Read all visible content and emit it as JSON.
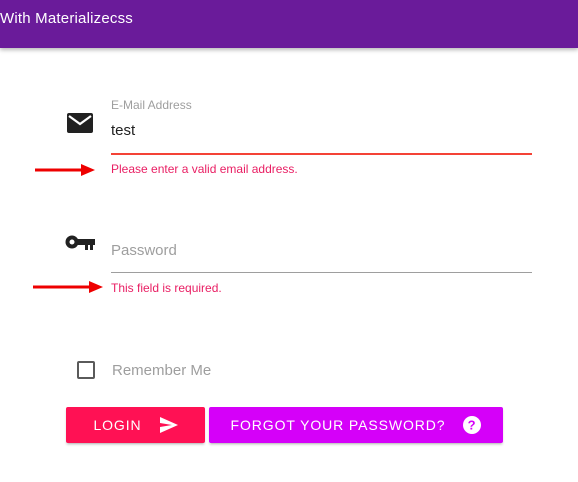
{
  "header": {
    "title": "With Materializecss"
  },
  "form": {
    "email": {
      "label": "E-Mail Address",
      "value": "test",
      "error": "Please enter a valid email address.",
      "icon": "email-icon"
    },
    "password": {
      "placeholder": "Password",
      "error": "This field is required.",
      "icon": "key-icon"
    },
    "remember": {
      "label": "Remember Me",
      "checked": false
    },
    "buttons": {
      "login_label": "LOGIN",
      "login_icon": "send-icon",
      "forgot_label": "FORGOT YOUR PASSWORD?",
      "forgot_icon": "help-icon"
    }
  },
  "annotations": {
    "arrow_color": "#ee0000"
  },
  "colors": {
    "header": "#6a1b9a",
    "error": "#e91e63",
    "error_underline": "#f44336",
    "login_button": "#ff1154",
    "forgot_button": "#d500f9"
  }
}
